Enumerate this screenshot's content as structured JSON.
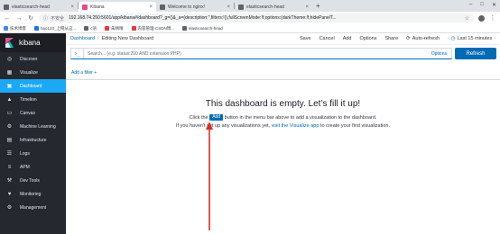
{
  "browser": {
    "tabs": [
      {
        "label": "elasticsearch-head",
        "color": "#5f6368",
        "active": false
      },
      {
        "label": "Kibana",
        "color": "#e8488b",
        "active": true
      },
      {
        "label": "Welcome to nginx!",
        "color": "#5f6368",
        "active": false
      },
      {
        "label": "elasticsearch-head",
        "color": "#5f6368",
        "active": false
      }
    ],
    "new_tab": "+",
    "window_controls": [
      "–",
      "□",
      "✕"
    ],
    "security_label": "ⓘ",
    "insecure_text": "不安全",
    "url": "192.168.74.250:5601/app/kibana#/dashboard?_g=()&_a=(description:'',filters:!(),fullScreenMode:!f,options:(darkTheme:!f,hidePanelT...",
    "star": "☆",
    "bookmarks": [
      {
        "label": "技术博客",
        "color": "#4285f4"
      },
      {
        "label": "hao123_上网从这...",
        "color": "#1a73e8"
      },
      {
        "label": "c语",
        "color": "#5f6368"
      },
      {
        "label": "朱晴晴",
        "color": "#e53935"
      },
      {
        "label": "内容管理-CSDN博...",
        "color": "#e53935"
      },
      {
        "label": "elasticsearch-head",
        "color": "#5f6368"
      }
    ]
  },
  "kibana": {
    "brand": "kibana",
    "nav": [
      {
        "key": "discover",
        "label": "Discover",
        "icon": "compass-icon",
        "glyph": "◎",
        "active": false
      },
      {
        "key": "visualize",
        "label": "Visualize",
        "icon": "chart-icon",
        "glyph": "▦",
        "active": false
      },
      {
        "key": "dashboard",
        "label": "Dashboard",
        "icon": "dashboard-icon",
        "glyph": "▣",
        "active": true
      },
      {
        "key": "timelion",
        "label": "Timelion",
        "icon": "timelion-icon",
        "glyph": "▲",
        "active": false
      },
      {
        "key": "canvas",
        "label": "Canvas",
        "icon": "canvas-icon",
        "glyph": "▭",
        "active": false
      },
      {
        "key": "ml",
        "label": "Machine Learning",
        "icon": "ml-icon",
        "glyph": "⚙",
        "active": false
      },
      {
        "key": "infrastructure",
        "label": "Infrastructure",
        "icon": "infrastructure-icon",
        "glyph": "▤",
        "active": false
      },
      {
        "key": "logs",
        "label": "Logs",
        "icon": "logs-icon",
        "glyph": "☰",
        "active": false
      },
      {
        "key": "apm",
        "label": "APM",
        "icon": "apm-icon",
        "glyph": "≡",
        "active": false
      },
      {
        "key": "devtools",
        "label": "Dev Tools",
        "icon": "wrench-icon",
        "glyph": "⚒",
        "active": false
      },
      {
        "key": "monitoring",
        "label": "Monitoring",
        "icon": "heartbeat-icon",
        "glyph": "♥",
        "active": false
      },
      {
        "key": "management",
        "label": "Management",
        "icon": "gear-icon",
        "glyph": "⚙",
        "active": false
      }
    ],
    "breadcrumb": {
      "root": "Dashboard",
      "separator": "/",
      "current": "Editing New Dashboard"
    },
    "menu": [
      "Save",
      "Cancel",
      "Add",
      "Options",
      "Share"
    ],
    "auto_refresh": "Auto-refresh",
    "time_range": "Last 15 minutes",
    "query": {
      "prompt": ">_",
      "placeholder": "Search... (e.g. status:200 AND extension:PHP)",
      "options": "Options"
    },
    "refresh_label": "Refresh",
    "add_filter": "Add a filter +",
    "empty": {
      "title": "This dashboard is empty. Let’s fill it up!",
      "line1_pre": "Click the",
      "add_chip": "Add",
      "line1_post": "button in the menu bar above to add a visualization to the dashboard.",
      "line2_pre": "If you haven't set up any visualizations yet,",
      "line2_link": "visit the Visualize app",
      "line2_post": "to create your first visualization."
    },
    "colors": {
      "sidebar": "#25282f",
      "accent": "#1ba9f5",
      "primary": "#006bb4",
      "annotation_arrow": "#d93025"
    }
  }
}
